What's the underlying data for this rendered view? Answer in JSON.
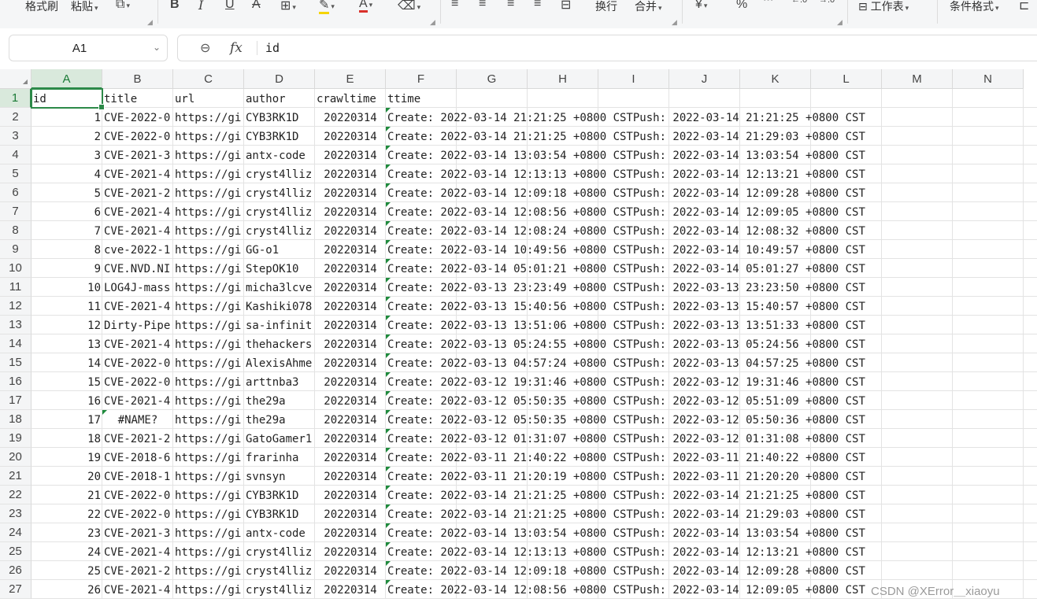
{
  "ribbon": {
    "format_painter": "格式刷",
    "paste": "粘贴",
    "bold": "B",
    "italic": "I",
    "underline": "U",
    "strike": "A",
    "wrap": "换行",
    "merge": "合并",
    "currency": "¥",
    "percent": "%",
    "worksheet": "工作表",
    "cond_format": "条件格式"
  },
  "formula_bar": {
    "cell_ref": "A1",
    "fx": "fx",
    "value": "id"
  },
  "columns": [
    "A",
    "B",
    "C",
    "D",
    "E",
    "F",
    "G",
    "H",
    "I",
    "J",
    "K",
    "L",
    "M",
    "N"
  ],
  "row_numbers": [
    "1",
    "2",
    "3",
    "4",
    "5",
    "6",
    "7",
    "8",
    "9",
    "10",
    "11",
    "12",
    "13",
    "14",
    "15",
    "16",
    "17",
    "18",
    "19",
    "20",
    "21",
    "22",
    "23",
    "24",
    "25",
    "26",
    "27"
  ],
  "header_row": [
    "id",
    "title",
    "url",
    "author",
    "crawltime",
    "ttime"
  ],
  "rows": [
    [
      "1",
      "CVE-2022-0",
      "https://gi",
      "CYB3RK1D",
      "20220314",
      "Create: 2022-03-14 21:21:25 +0800 CSTPush: 2022-03-14 21:21:25 +0800 CST"
    ],
    [
      "2",
      "CVE-2022-0",
      "https://gi",
      "CYB3RK1D",
      "20220314",
      "Create: 2022-03-14 21:21:25 +0800 CSTPush: 2022-03-14 21:29:03 +0800 CST"
    ],
    [
      "3",
      "CVE-2021-3",
      "https://gi",
      "antx-code",
      "20220314",
      "Create: 2022-03-14 13:03:54 +0800 CSTPush: 2022-03-14 13:03:54 +0800 CST"
    ],
    [
      "4",
      "CVE-2021-4",
      "https://gi",
      "cryst4lliz",
      "20220314",
      "Create: 2022-03-14 12:13:13 +0800 CSTPush: 2022-03-14 12:13:21 +0800 CST"
    ],
    [
      "5",
      "CVE-2021-2",
      "https://gi",
      "cryst4lliz",
      "20220314",
      "Create: 2022-03-14 12:09:18 +0800 CSTPush: 2022-03-14 12:09:28 +0800 CST"
    ],
    [
      "6",
      "CVE-2021-4",
      "https://gi",
      "cryst4lliz",
      "20220314",
      "Create: 2022-03-14 12:08:56 +0800 CSTPush: 2022-03-14 12:09:05 +0800 CST"
    ],
    [
      "7",
      "CVE-2021-4",
      "https://gi",
      "cryst4lliz",
      "20220314",
      "Create: 2022-03-14 12:08:24 +0800 CSTPush: 2022-03-14 12:08:32 +0800 CST"
    ],
    [
      "8",
      "cve-2022-1",
      "https://gi",
      "GG-o1",
      "20220314",
      "Create: 2022-03-14 10:49:56 +0800 CSTPush: 2022-03-14 10:49:57 +0800 CST"
    ],
    [
      "9",
      "CVE.NVD.NI",
      "https://gi",
      "StepOK10",
      "20220314",
      "Create: 2022-03-14 05:01:21 +0800 CSTPush: 2022-03-14 05:01:27 +0800 CST"
    ],
    [
      "10",
      "LOG4J-mass",
      "https://gi",
      "micha3lcve",
      "20220314",
      "Create: 2022-03-13 23:23:49 +0800 CSTPush: 2022-03-13 23:23:50 +0800 CST"
    ],
    [
      "11",
      "CVE-2021-4",
      "https://gi",
      "Kashiki078",
      "20220314",
      "Create: 2022-03-13 15:40:56 +0800 CSTPush: 2022-03-13 15:40:57 +0800 CST"
    ],
    [
      "12",
      "Dirty-Pipe",
      "https://gi",
      "sa-infinit",
      "20220314",
      "Create: 2022-03-13 13:51:06 +0800 CSTPush: 2022-03-13 13:51:33 +0800 CST"
    ],
    [
      "13",
      "CVE-2021-4",
      "https://gi",
      "thehackers",
      "20220314",
      "Create: 2022-03-13 05:24:55 +0800 CSTPush: 2022-03-13 05:24:56 +0800 CST"
    ],
    [
      "14",
      "CVE-2022-0",
      "https://gi",
      "AlexisAhme",
      "20220314",
      "Create: 2022-03-13 04:57:24 +0800 CSTPush: 2022-03-13 04:57:25 +0800 CST"
    ],
    [
      "15",
      "CVE-2022-0",
      "https://gi",
      "arttnba3",
      "20220314",
      "Create: 2022-03-12 19:31:46 +0800 CSTPush: 2022-03-12 19:31:46 +0800 CST"
    ],
    [
      "16",
      "CVE-2021-4",
      "https://gi",
      "the29a",
      "20220314",
      "Create: 2022-03-12 05:50:35 +0800 CSTPush: 2022-03-12 05:51:09 +0800 CST"
    ],
    [
      "17",
      "#NAME?",
      "https://gi",
      "the29a",
      "20220314",
      "Create: 2022-03-12 05:50:35 +0800 CSTPush: 2022-03-12 05:50:36 +0800 CST"
    ],
    [
      "18",
      "CVE-2021-2",
      "https://gi",
      "GatoGamer1",
      "20220314",
      "Create: 2022-03-12 01:31:07 +0800 CSTPush: 2022-03-12 01:31:08 +0800 CST"
    ],
    [
      "19",
      "CVE-2018-6",
      "https://gi",
      "frarinha",
      "20220314",
      "Create: 2022-03-11 21:40:22 +0800 CSTPush: 2022-03-11 21:40:22 +0800 CST"
    ],
    [
      "20",
      "CVE-2018-1",
      "https://gi",
      "svnsyn",
      "20220314",
      "Create: 2022-03-11 21:20:19 +0800 CSTPush: 2022-03-11 21:20:20 +0800 CST"
    ],
    [
      "21",
      "CVE-2022-0",
      "https://gi",
      "CYB3RK1D",
      "20220314",
      "Create: 2022-03-14 21:21:25 +0800 CSTPush: 2022-03-14 21:21:25 +0800 CST"
    ],
    [
      "22",
      "CVE-2022-0",
      "https://gi",
      "CYB3RK1D",
      "20220314",
      "Create: 2022-03-14 21:21:25 +0800 CSTPush: 2022-03-14 21:29:03 +0800 CST"
    ],
    [
      "23",
      "CVE-2021-3",
      "https://gi",
      "antx-code",
      "20220314",
      "Create: 2022-03-14 13:03:54 +0800 CSTPush: 2022-03-14 13:03:54 +0800 CST"
    ],
    [
      "24",
      "CVE-2021-4",
      "https://gi",
      "cryst4lliz",
      "20220314",
      "Create: 2022-03-14 12:13:13 +0800 CSTPush: 2022-03-14 12:13:21 +0800 CST"
    ],
    [
      "25",
      "CVE-2021-2",
      "https://gi",
      "cryst4lliz",
      "20220314",
      "Create: 2022-03-14 12:09:18 +0800 CSTPush: 2022-03-14 12:09:28 +0800 CST"
    ],
    [
      "26",
      "CVE-2021-4",
      "https://gi",
      "cryst4lliz",
      "20220314",
      "Create: 2022-03-14 12:08:56 +0800 CSTPush: 2022-03-14 12:09:05 +0800 CST"
    ]
  ],
  "watermark": "CSDN @XError＿xiaoyu",
  "colors": {
    "selection": "#2d8a49",
    "header_bg": "#f4f5f6",
    "gridline": "#e3e3e3",
    "font_red": "#d9312b",
    "highlight_yellow": "#f5d400"
  }
}
